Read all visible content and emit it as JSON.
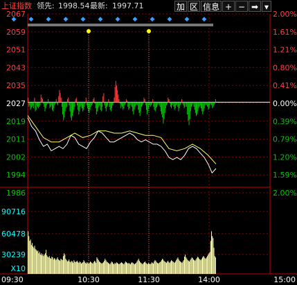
{
  "header": {
    "index_name": "上证指数",
    "lead_label": "领先:",
    "lead_value": "1998.54",
    "latest_label": "最新:",
    "latest_value": "1997.71"
  },
  "toolbar": {
    "add_label": "加",
    "zone_label": "区",
    "info_label": "信息",
    "plus_label": "+",
    "minus_label": "−",
    "arrow_label": "➡",
    "dropdown_label": "▾"
  },
  "price_axis": {
    "left": [
      "2067",
      "2059",
      "2051",
      "2043",
      "2035",
      "2027",
      "2019",
      "2011",
      "2002",
      "1994",
      "1986"
    ],
    "right": [
      "2.00%",
      "1.61%",
      "1.21%",
      "0.80%",
      "0.41%",
      "0.00%",
      "0.39%",
      "0.79%",
      "1.20%",
      "1.59%",
      "2.00%"
    ]
  },
  "volume_axis": {
    "left": [
      "90716",
      "60478",
      "30239"
    ],
    "multiplier": "X10"
  },
  "time_axis": [
    "09:30",
    "10:30",
    "11:30",
    "14:00",
    "15:00"
  ],
  "colors": {
    "up": "#ff3a3a",
    "down": "#00c800",
    "price_line": "#ffffff",
    "avg_line": "#ffff66",
    "grid": "#8b0000",
    "axis_text_left": "#ff4040",
    "volume_text": "#00ffff",
    "volume_bar": "#ffffb0",
    "marker": "#ffff00"
  },
  "chart_data": {
    "type": "line",
    "title": "上证指数",
    "base_value": 2027,
    "ylim": [
      1986,
      2067
    ],
    "x_range": [
      0,
      240
    ],
    "series": [
      {
        "name": "最新",
        "x": [
          0,
          5,
          10,
          15,
          20,
          25,
          30,
          35,
          40,
          45,
          50,
          55,
          60,
          65,
          70,
          75,
          80,
          85,
          90,
          95,
          100,
          105,
          110,
          115,
          120,
          125,
          130,
          135,
          140,
          145,
          150,
          155,
          160,
          165,
          170,
          175,
          180,
          185,
          190,
          195,
          200,
          205,
          210,
          215,
          220,
          225,
          230,
          235,
          240
        ],
        "values": [
          2020,
          2016,
          2014,
          2010,
          2007,
          2008,
          2005,
          2006,
          2007,
          2006,
          2008,
          2012,
          2011,
          2008,
          2007,
          2006,
          2009,
          2011,
          2014,
          2013,
          2011,
          2009,
          2009,
          2010,
          2011,
          2012,
          2013,
          2012,
          2010,
          2009,
          2010,
          2009,
          2008,
          2008,
          2007,
          2005,
          2002,
          2001,
          2002,
          2001,
          2003,
          2006,
          2007,
          2006,
          2004,
          2002,
          1999,
          1995,
          1997
        ]
      },
      {
        "name": "领先",
        "x": [
          0,
          10,
          20,
          30,
          40,
          50,
          60,
          70,
          80,
          90,
          100,
          110,
          120,
          130,
          140,
          150,
          160,
          170,
          180,
          190,
          200,
          210,
          220,
          230,
          240
        ],
        "values": [
          2021,
          2016,
          2011,
          2009,
          2009,
          2011,
          2013,
          2011,
          2012,
          2014,
          2014,
          2013,
          2013,
          2014,
          2013,
          2012,
          2012,
          2011,
          2006,
          2005,
          2006,
          2008,
          2006,
          2003,
          1999
        ]
      }
    ],
    "lead_bars": [
      3,
      -3,
      -2,
      -5,
      -4,
      -3,
      -2,
      -4,
      3,
      -6,
      -5,
      -2,
      -3,
      -4,
      -3,
      -2,
      5,
      3,
      2,
      -1,
      -3,
      -6,
      -4,
      -2,
      -1,
      2,
      -1,
      -4,
      -3,
      -2,
      -5,
      -6,
      -4,
      -2,
      -1,
      2,
      -1,
      -2,
      4,
      8,
      6,
      3,
      -3,
      -8,
      -12,
      -10,
      -6,
      -4,
      -3,
      2,
      3,
      -2,
      -6,
      -10,
      -12,
      -9,
      -7,
      -5,
      -3,
      2,
      3,
      -2,
      -5,
      -8,
      -6,
      -3,
      -2,
      -4,
      -6,
      -5,
      -3,
      -1,
      3,
      -2,
      -4,
      -6,
      -7,
      -5,
      -3,
      -2,
      -1,
      2,
      3,
      -1,
      -4,
      -8,
      -6,
      -4,
      -3,
      -2,
      -5,
      -6,
      -3,
      4,
      6,
      -2,
      -4,
      -6,
      -3,
      -2,
      2,
      -3,
      -5,
      -6,
      -4,
      -2,
      -1,
      3,
      10,
      14,
      11,
      8,
      5,
      2,
      -1,
      -4,
      -2,
      -3,
      -5,
      -4,
      -2,
      -1,
      2,
      1,
      -3,
      -5,
      -4,
      -2,
      -1,
      -3,
      -6,
      -8,
      -5,
      -3,
      -2,
      -1,
      -2,
      -5,
      -7,
      -9,
      -6,
      -3,
      -2,
      -1,
      3,
      2,
      -2,
      -5,
      -8,
      -6,
      -4,
      -2,
      -3,
      -2,
      -1,
      2,
      -3,
      -5,
      -6,
      -4,
      -3,
      -2,
      -1,
      -2,
      -3,
      -6,
      -8,
      -10,
      -14,
      -11,
      -7,
      -4,
      -2,
      -1,
      3,
      2,
      -1,
      -3,
      -4,
      -2,
      -1,
      -3,
      -5,
      -4,
      -2,
      -1,
      -3,
      -6,
      -4,
      -2,
      -1,
      2,
      -1,
      -2,
      -4,
      -3,
      -1,
      -3,
      -8,
      -12,
      -15,
      -11,
      -6,
      -3,
      -2,
      -1,
      -3,
      -5,
      -7,
      -9,
      -8,
      -6,
      -4,
      -3,
      -2,
      -4,
      -6,
      -8,
      -6,
      -4,
      -2,
      -1,
      -2,
      -3,
      -5,
      -4,
      -2,
      -1,
      -2,
      -4,
      -3,
      -2,
      -1,
      2
    ],
    "volume": [
      62000,
      55000,
      48000,
      50000,
      42000,
      45000,
      40000,
      38000,
      41000,
      36000,
      35000,
      33000,
      34000,
      30000,
      32000,
      28000,
      30000,
      27000,
      29000,
      26000,
      28000,
      30000,
      35000,
      27000,
      25000,
      24000,
      26000,
      23000,
      22000,
      25000,
      24000,
      21000,
      23000,
      22000,
      20000,
      22000,
      24000,
      21000,
      20000,
      19000,
      22000,
      21000,
      20000,
      26000,
      30000,
      28000,
      22000,
      20000,
      18000,
      19000,
      21000,
      18000,
      17000,
      19000,
      18000,
      16000,
      20000,
      18000,
      17000,
      18000,
      19000,
      17000,
      16000,
      18000,
      17000,
      15000,
      16000,
      17000,
      20000,
      18000,
      16000,
      15000,
      17000,
      16000,
      15000,
      16000,
      18000,
      17000,
      16000,
      15000,
      17000,
      19000,
      18000,
      16000,
      24000,
      22000,
      20000,
      18000,
      17000,
      16000,
      15000,
      16000,
      17000,
      19000,
      22000,
      20000,
      18000,
      17000,
      16000,
      15000,
      14000,
      16000,
      18000,
      17000,
      15000,
      14000,
      16000,
      15000,
      17000,
      16000,
      15000,
      14000,
      15000,
      16000,
      17000,
      16000,
      15000,
      14000,
      16000,
      18000,
      17000,
      16000,
      15000,
      16000,
      15000,
      14000,
      16000,
      17000,
      16000,
      15000,
      14000,
      15000,
      16000,
      18000,
      20000,
      22000,
      19000,
      17000,
      16000,
      15000,
      14000,
      16000,
      17000,
      18000,
      16000,
      15000,
      14000,
      16000,
      15000,
      14000,
      15000,
      17000,
      16000,
      15000,
      18000,
      20000,
      19000,
      17000,
      16000,
      15000,
      16000,
      17000,
      18000,
      20000,
      22000,
      21000,
      19000,
      18000,
      17000,
      16000,
      18000,
      19000,
      17000,
      16000,
      18000,
      20000,
      19000,
      18000,
      17000,
      16000,
      18000,
      20000,
      22000,
      24000,
      21000,
      19000,
      18000,
      17000,
      16000,
      18000,
      20000,
      25000,
      28000,
      24000,
      22000,
      20000,
      19000,
      18000,
      20000,
      22000,
      24000,
      23000,
      21000,
      20000,
      19000,
      21000,
      23000,
      25000,
      24000,
      22000,
      21000,
      20000,
      22000,
      24000,
      26000,
      25000,
      23000,
      22000,
      24000,
      26000,
      28000,
      30000,
      32000,
      48000,
      62000,
      55000,
      52000,
      38000,
      26000,
      24000
    ]
  }
}
